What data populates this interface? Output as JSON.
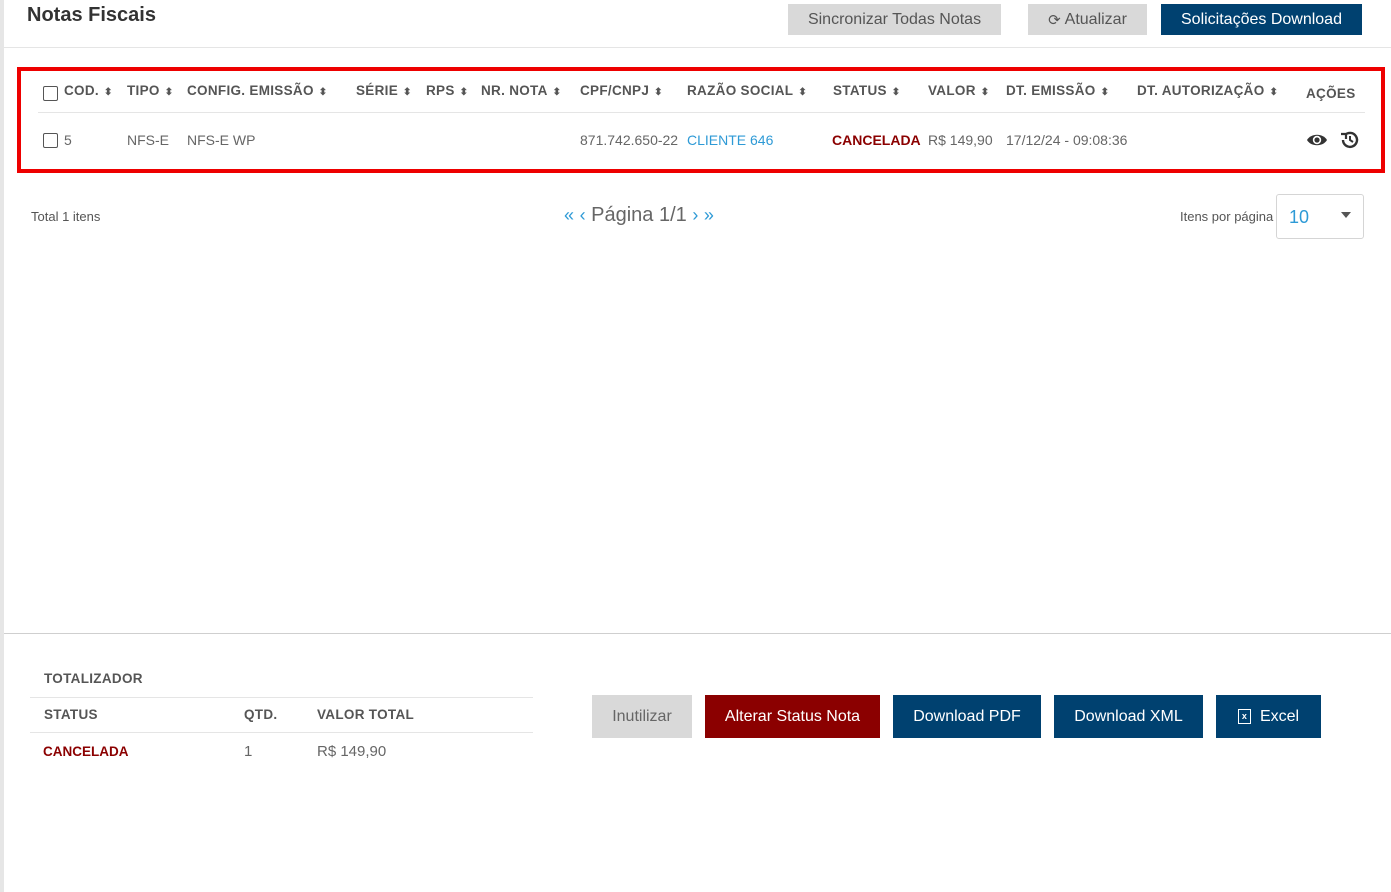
{
  "header": {
    "title": "Notas Fiscais",
    "sync_all_label": "Sincronizar Todas Notas",
    "refresh_label": "Atualizar",
    "download_requests_label": "Solicitações Download"
  },
  "table": {
    "columns": [
      "COD.",
      "TIPO",
      "CONFIG. EMISSÃO",
      "SÉRIE",
      "RPS",
      "NR. NOTA",
      "CPF/CNPJ",
      "RAZÃO SOCIAL",
      "STATUS",
      "VALOR",
      "DT. EMISSÃO",
      "DT. AUTORIZAÇÃO",
      "AÇÕES"
    ],
    "rows": [
      {
        "cod": "5",
        "tipo": "NFS-E",
        "config_emissao": "NFS-E WP",
        "serie": "",
        "rps": "",
        "nr_nota": "",
        "cpf_cnpj": "871.742.650-22",
        "razao_social": "CLIENTE 646",
        "status": "CANCELADA",
        "valor": "R$ 149,90",
        "dt_emissao": "17/12/24 - 09:08:36",
        "dt_autorizacao": "",
        "actions": [
          "eye-icon",
          "history-icon"
        ]
      }
    ]
  },
  "pagination": {
    "total_text": "Total 1 itens",
    "page_text": "Página 1/1",
    "first_glyph": "«",
    "prev_glyph": "‹",
    "next_glyph": "›",
    "last_glyph": "»",
    "per_page_label": "Itens por página",
    "per_page_value": "10"
  },
  "totalizer": {
    "title": "TOTALIZADOR",
    "columns": [
      "STATUS",
      "QTD.",
      "VALOR TOTAL"
    ],
    "rows": [
      {
        "status": "CANCELADA",
        "qtd": "1",
        "valor_total": "R$ 149,90"
      }
    ]
  },
  "footer_buttons": {
    "inutilizar": "Inutilizar",
    "alterar_status": "Alterar Status Nota",
    "download_pdf": "Download PDF",
    "download_xml": "Download XML",
    "excel": "Excel"
  },
  "colors": {
    "primary": "#004170",
    "danger": "#8b0000",
    "link": "#2e9ad6",
    "highlight": "#ee0000",
    "neutral_button": "#d9d9d9"
  }
}
